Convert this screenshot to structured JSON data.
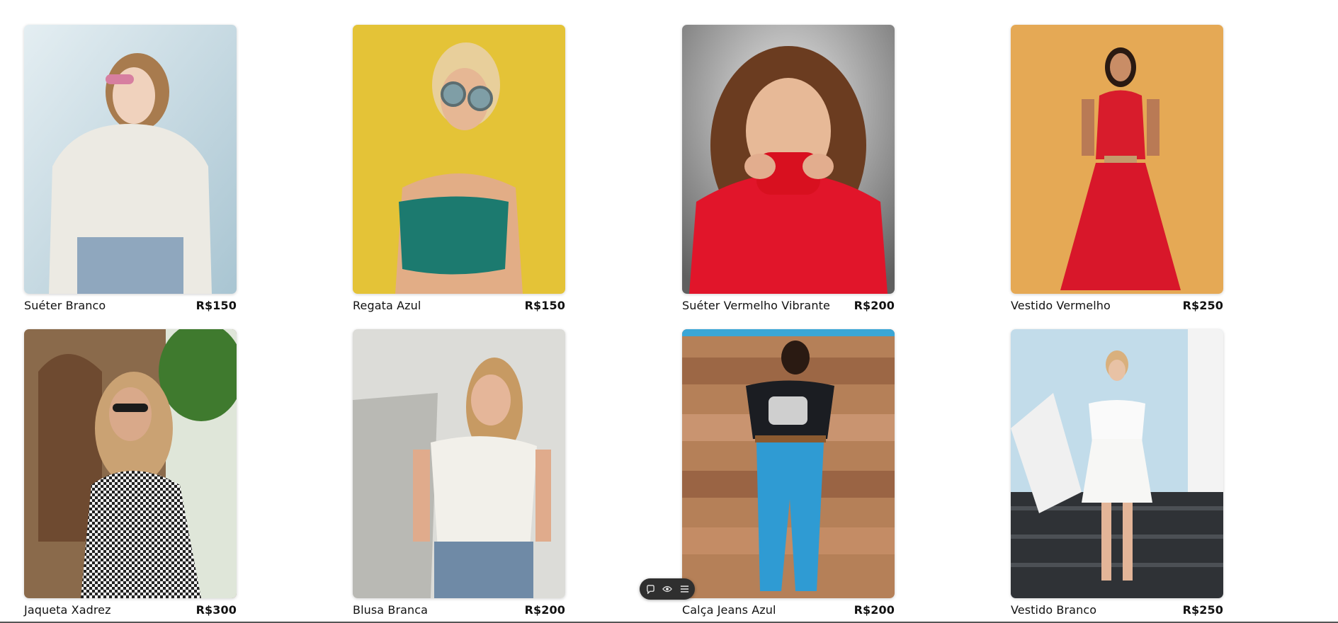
{
  "products": [
    {
      "name": "Suéter Branco",
      "price": "R$150",
      "image": "woman-white-sweater-sunglasses",
      "bg": "#cfe1ea"
    },
    {
      "name": "Regata Azul",
      "price": "R$150",
      "image": "woman-teal-tank-top-round-sunglasses",
      "bg": "#e8c83b"
    },
    {
      "name": "Suéter Vermelho Vibrante",
      "price": "R$200",
      "image": "woman-red-turtleneck-sweater",
      "bg": "#9a9a9a"
    },
    {
      "name": "Vestido Vermelho",
      "price": "R$250",
      "image": "woman-red-floral-dress",
      "bg": "#e3a853"
    },
    {
      "name": "Jaqueta Xadrez",
      "price": "R$300",
      "image": "woman-checkered-jacket-street",
      "bg": "#8c6a48"
    },
    {
      "name": "Blusa Branca",
      "price": "R$200",
      "image": "woman-white-knit-top-jeans",
      "bg": "#d6d6d2"
    },
    {
      "name": "Calça Jeans Azul",
      "price": "R$200",
      "image": "woman-blue-jeans-wood-wall",
      "bg": "#b07a55"
    },
    {
      "name": "Vestido Branco",
      "price": "R$250",
      "image": "woman-white-dress-stairs",
      "bg": "#c3dcea"
    }
  ],
  "toolbar": {
    "buttons": [
      "comment-icon",
      "eye-icon",
      "menu-icon"
    ]
  }
}
